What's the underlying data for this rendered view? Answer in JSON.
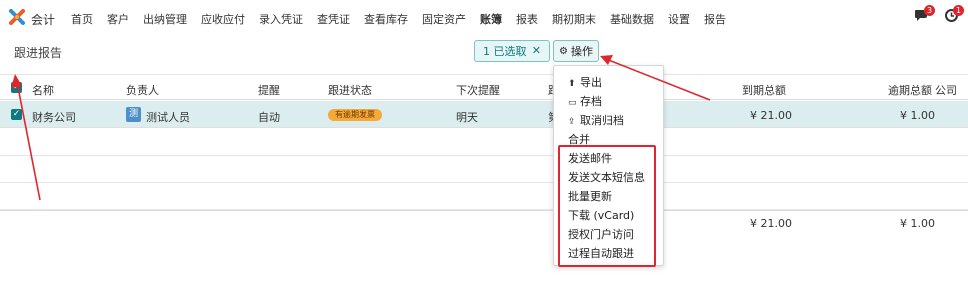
{
  "topbar": {
    "app_name": "会计",
    "menu": [
      "首页",
      "客户",
      "出纳管理",
      "应收应付",
      "录入凭证",
      "查凭证",
      "查看库存",
      "固定资产",
      "账簿",
      "报表",
      "期初期末",
      "基础数据",
      "设置",
      "报告"
    ],
    "active_menu_index": 8,
    "chat_badge": "3",
    "clock_badge": "1"
  },
  "page": {
    "title": "跟进报告",
    "selection_label": "1 已选取",
    "selection_clear": "✕",
    "operation_label": "操作"
  },
  "table": {
    "headers": {
      "name": "名称",
      "owner": "负责人",
      "reminder": "提醒",
      "status": "跟进状态",
      "next": "下次提醒",
      "hidden": "跟",
      "due_total": "到期总额",
      "overdue_total": "逾期总额",
      "company": "公司"
    },
    "rows": [
      {
        "name": "财务公司",
        "owner_initial": "测",
        "owner": "测试人员",
        "reminder": "自动",
        "status": "有逾期发票",
        "next": "明天",
        "hidden": "第",
        "due_total": "¥ 21.00",
        "overdue_total": "¥ 1.00"
      }
    ],
    "totals": {
      "due_total": "¥ 21.00",
      "overdue_total": "¥ 1.00"
    }
  },
  "dropdown": {
    "items": [
      {
        "label": "导出",
        "icon": "upload-icon"
      },
      {
        "label": "存档",
        "icon": "archive-icon"
      },
      {
        "label": "取消归档",
        "icon": "unarchive-icon"
      },
      {
        "label": "合并",
        "icon": ""
      },
      {
        "label": "发送邮件",
        "icon": ""
      },
      {
        "label": "发送文本短信息",
        "icon": ""
      },
      {
        "label": "批量更新",
        "icon": ""
      },
      {
        "label": "下载 (vCard)",
        "icon": ""
      },
      {
        "label": "授权门户访问",
        "icon": ""
      },
      {
        "label": "过程自动跟进",
        "icon": ""
      }
    ]
  },
  "colors": {
    "accent": "#0e7a80",
    "selected_row": "#dcedf0",
    "badge": "#f7a83a",
    "annotation_red": "#e1252e"
  }
}
